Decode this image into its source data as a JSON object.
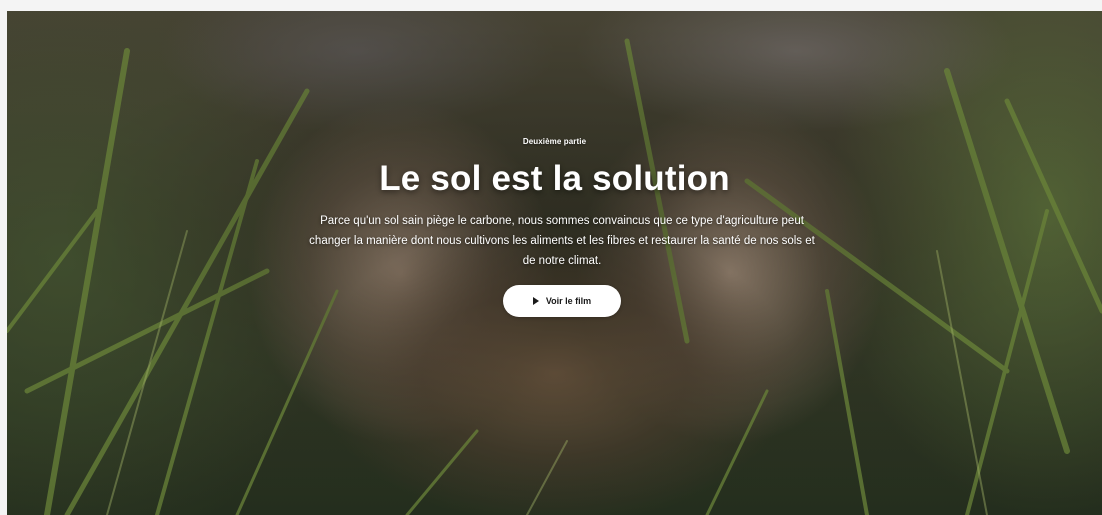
{
  "hero": {
    "eyebrow": "Deuxième partie",
    "title": "Le sol est la solution",
    "lead": "Parce qu'un sol sain piège le carbone, nous sommes convaincus que ce type d'agriculture peut changer la manière dont nous cultivons les aliments et les fibres et restaurer la santé de nos sols et de notre climat.",
    "cta_label": "Voir le film",
    "cta_icon": "play-icon",
    "background_image": "hands-holding-soil-in-grass"
  },
  "colors": {
    "text": "#ffffff",
    "button_bg": "#ffffff",
    "button_text": "#1a1a1a"
  }
}
